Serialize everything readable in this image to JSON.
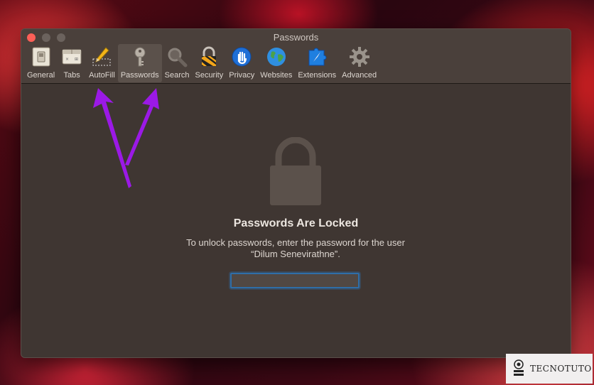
{
  "window": {
    "title": "Passwords"
  },
  "toolbar": {
    "items": [
      {
        "label": "General",
        "icon": "general-switch-icon"
      },
      {
        "label": "Tabs",
        "icon": "tabs-icon"
      },
      {
        "label": "AutoFill",
        "icon": "autofill-pencil-icon"
      },
      {
        "label": "Passwords",
        "icon": "key-icon",
        "selected": true
      },
      {
        "label": "Search",
        "icon": "magnifier-icon"
      },
      {
        "label": "Security",
        "icon": "padlock-icon"
      },
      {
        "label": "Privacy",
        "icon": "hand-icon"
      },
      {
        "label": "Websites",
        "icon": "globe-icon"
      },
      {
        "label": "Extensions",
        "icon": "puzzle-compass-icon"
      },
      {
        "label": "Advanced",
        "icon": "gear-icon"
      }
    ]
  },
  "locked": {
    "title": "Passwords Are Locked",
    "message": "To unlock passwords, enter the password for the user “Dilum Senevirathne”.",
    "password_value": ""
  },
  "watermark": {
    "text": "TECNOTUTO"
  },
  "colors": {
    "window_bg": "#3f3632",
    "focus_ring": "#2f6ea8",
    "annotation_arrow": "#9b19e6",
    "close_button": "#fc5f57"
  }
}
